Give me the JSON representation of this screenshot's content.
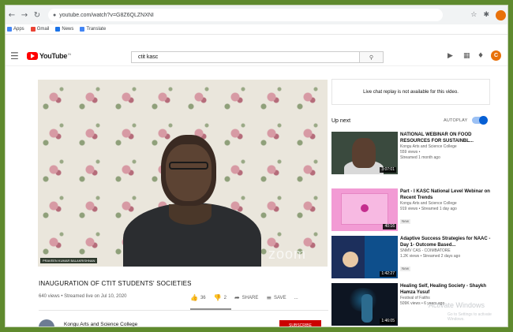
{
  "browser": {
    "url": "youtube.com/watch?v=G8Z6QLZNXNI",
    "bookmarks": [
      {
        "label": "Apps",
        "color": "#4285f4"
      },
      {
        "label": "Gmail",
        "color": "#ea4335"
      },
      {
        "label": "News",
        "color": "#1a73e8"
      },
      {
        "label": "Translate",
        "color": "#4285f4"
      }
    ]
  },
  "youtube": {
    "logo_text": "YouTube",
    "logo_region": "IN",
    "search_query": "ctit kasc",
    "avatar_initial": "C"
  },
  "video": {
    "name_tag": "PRAVEEN KUMAR BALAKRISHNAN",
    "watermark": "zoom",
    "title": "INAUGURATION OF CTIT STUDENTS' SOCIETIES",
    "meta": "640 views • Streamed live on Jul 10, 2020",
    "likes": "36",
    "dislikes": "2",
    "share_label": "SHARE",
    "save_label": "SAVE",
    "more_label": "...",
    "channel": "Kongu Arts and Science College",
    "subscribe_label": "SUBSCRIBE"
  },
  "sidebar": {
    "chat_replay": "Live chat replay is not available for this video.",
    "up_next": "Up next",
    "autoplay": "AUTOPLAY",
    "recs": [
      {
        "title": "NATIONAL WEBINAR ON FOOD RESOURCES FOR SUSTAINBL...",
        "channel": "Kongu Arts and Science College",
        "views": "559 views •",
        "age": "Streamed 1 month ago",
        "duration": "3:07:01",
        "badge": ""
      },
      {
        "title": "Part - I KASC National Level Webinar on Recent Trends",
        "channel": "Kongu Arts and Science College",
        "views": "919 views • Streamed 1 day ago",
        "age": "",
        "duration": "40:16",
        "badge": "New"
      },
      {
        "title": "Adaptive Success Strategies for NAAC - Day 1- Outcome Based...",
        "channel": "SNMV CAS - COIMBATORE",
        "views": "1.2K views • Streamed 2 days ago",
        "age": "",
        "duration": "1:42:27",
        "badge": "New"
      },
      {
        "title": "Healing Self, Healing Society - Shaykh Hamza Yusuf",
        "channel": "Festival of Faiths",
        "views": "509K views • 6 years ago",
        "age": "",
        "duration": "1:46:05",
        "badge": ""
      }
    ]
  },
  "os_watermark": {
    "line1": "Activate Windows",
    "line2": "Go to Settings to activate Windows."
  }
}
